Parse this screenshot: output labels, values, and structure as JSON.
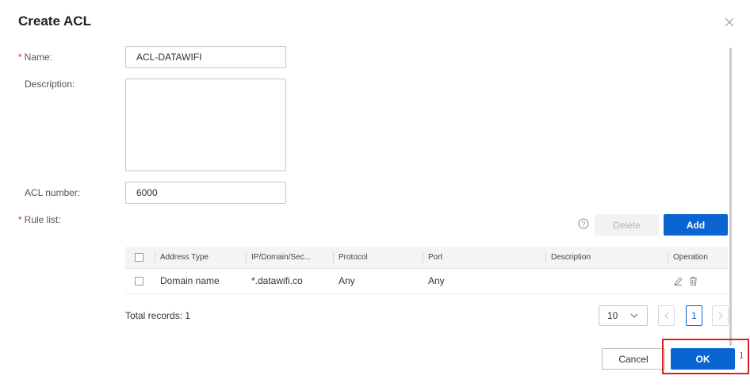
{
  "dialog": {
    "title": "Create ACL",
    "close_icon": "close-icon"
  },
  "form": {
    "name_label": "Name:",
    "name_value": "ACL-DATAWIFI",
    "description_label": "Description:",
    "description_value": "",
    "acl_number_label": "ACL number:",
    "acl_number_value": "6000",
    "rule_list_label": "Rule list:",
    "required_mark": "*"
  },
  "rule_toolbar": {
    "help_icon": "question-circle-icon",
    "delete_label": "Delete",
    "add_label": "Add"
  },
  "table": {
    "columns": [
      "Address Type",
      "IP/Domain/Sec...",
      "Protocol",
      "Port",
      "Description",
      "Operation"
    ],
    "rows": [
      {
        "address_type": "Domain name",
        "ip_domain": "*.datawifi.co",
        "protocol": "Any",
        "port": "Any",
        "description": ""
      }
    ]
  },
  "pagination": {
    "total_records": "Total records: 1",
    "page_size": "10",
    "current_page": "1"
  },
  "footer": {
    "cancel_label": "Cancel",
    "ok_label": "OK"
  },
  "annotation": {
    "marker": "1",
    "color": "#e02020"
  },
  "colors": {
    "primary": "#0a64d2",
    "required": "#e02424"
  }
}
